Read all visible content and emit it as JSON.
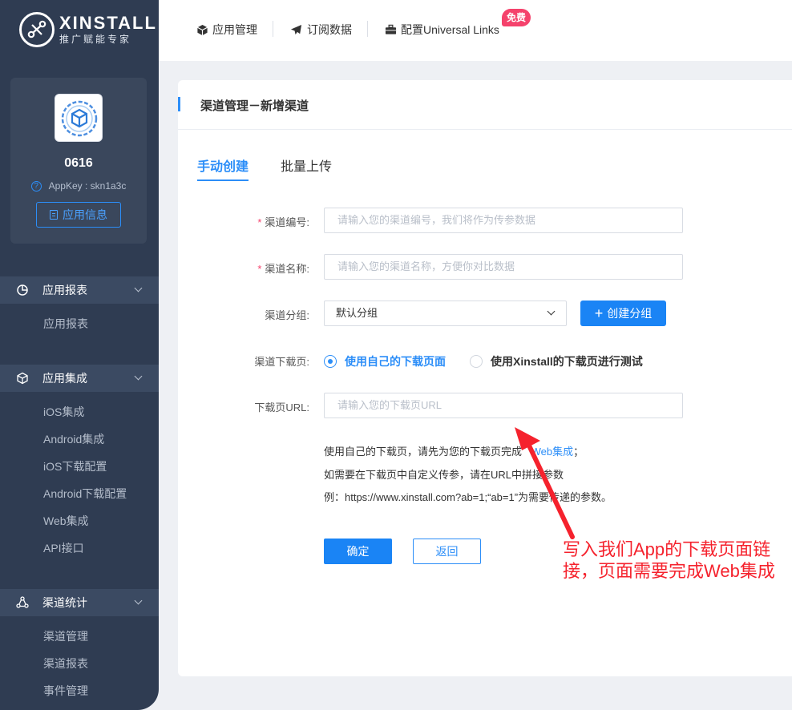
{
  "brand": {
    "name": "XINSTALL",
    "slogan": "推广赋能专家"
  },
  "app": {
    "name": "0616",
    "appkey": "AppKey : skn1a3c",
    "info_button": "应用信息"
  },
  "sidebar": {
    "groups": [
      {
        "label": "应用报表",
        "icon": "pie-chart-icon",
        "items": [
          "应用报表"
        ]
      },
      {
        "label": "应用集成",
        "icon": "cube-icon",
        "items": [
          "iOS集成",
          "Android集成",
          "iOS下载配置",
          "Android下载配置",
          "Web集成",
          "API接口"
        ]
      },
      {
        "label": "渠道统计",
        "icon": "share-nodes-icon",
        "items": [
          "渠道管理",
          "渠道报表",
          "事件管理"
        ]
      }
    ]
  },
  "topbar": {
    "items": [
      {
        "label": "应用管理",
        "icon": "cube-icon"
      },
      {
        "label": "订阅数据",
        "icon": "paper-plane-icon"
      },
      {
        "label": "配置Universal Links",
        "icon": "briefcase-icon"
      }
    ],
    "badge": "免费"
  },
  "card": {
    "title": "渠道管理－新增渠道",
    "tabs": [
      "手动创建",
      "批量上传"
    ],
    "form": {
      "channel_no_label": "渠道编号:",
      "channel_no_placeholder": "请输入您的渠道编号，我们将作为传参数据",
      "channel_name_label": "渠道名称:",
      "channel_name_placeholder": "请输入您的渠道名称，方便你对比数据",
      "group_label": "渠道分组:",
      "group_value": "默认分组",
      "create_group_button": "创建分组",
      "download_page_label": "渠道下载页:",
      "radio_own": "使用自己的下载页面",
      "radio_xinstall": "使用Xinstall的下载页进行测试",
      "url_label": "下载页URL:",
      "url_placeholder": "请输入您的下载页URL"
    },
    "hints": {
      "line1_prefix": "使用自己的下载页，请先为您的下载页完成",
      "line1_link": "Web集成",
      "line1_suffix": "；",
      "line2": "如需要在下载页中自定义传参，请在URL中拼接参数",
      "line3": "例：https://www.xinstall.com?ab=1;“ab=1”为需要传递的参数。"
    },
    "confirm_button": "确定",
    "back_button": "返回"
  },
  "annotation": {
    "text": "写入我们App的下载页面链接，页面需要完成Web集成",
    "color": "#f5222d"
  },
  "colors": {
    "accent": "#2c8ef8",
    "sidebar": "#2f3c52",
    "required": "#f5426c"
  }
}
